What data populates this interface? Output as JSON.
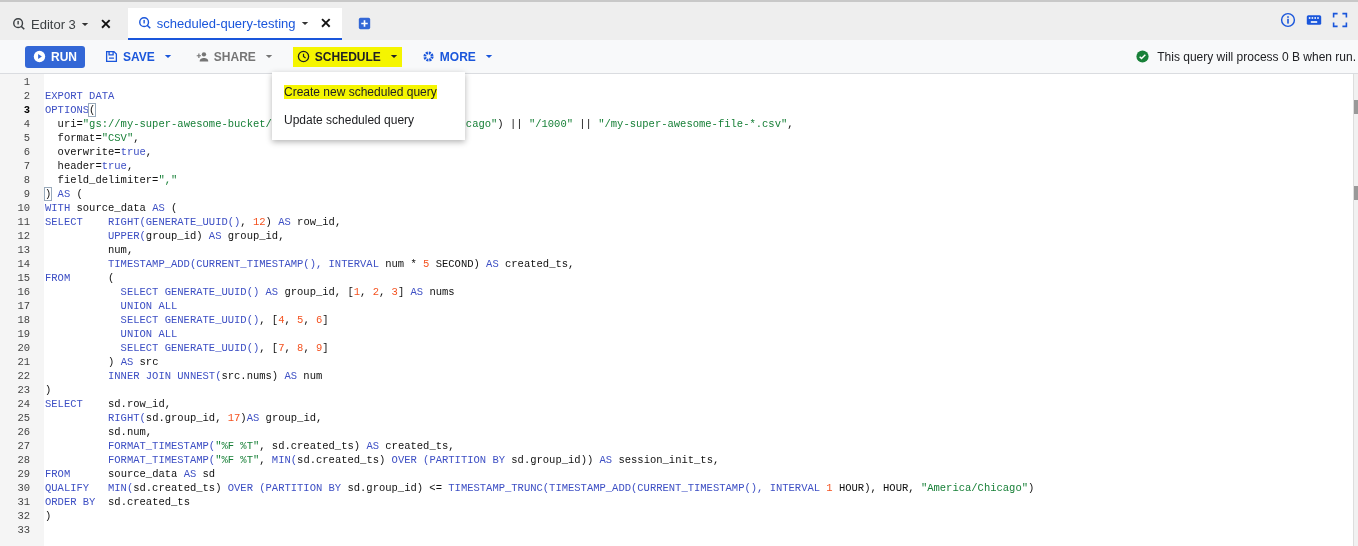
{
  "tabs": [
    {
      "label": "Editor 3",
      "selected": false,
      "close": "✕"
    },
    {
      "label": "scheduled-query-testing",
      "selected": true,
      "close": "✕"
    }
  ],
  "toolbar": [
    {
      "kind": "primary",
      "label": "RUN",
      "highlighted": false,
      "disabled": false
    },
    {
      "kind": "save",
      "label": "SAVE",
      "highlighted": false,
      "disabled": false
    },
    {
      "kind": "share",
      "label": "SHARE",
      "highlighted": false,
      "disabled": true
    },
    {
      "kind": "schedule",
      "label": "SCHEDULE",
      "highlighted": true,
      "disabled": false
    },
    {
      "kind": "more",
      "label": "MORE",
      "highlighted": false,
      "disabled": false
    }
  ],
  "status": "This query will process 0 B when run.",
  "schedule_menu": [
    {
      "label": "Create new scheduled query",
      "highlighted": true
    },
    {
      "label": "Update scheduled query",
      "highlighted": false
    }
  ],
  "editor": {
    "lines": [
      {
        "n": "1",
        "current": false
      },
      {
        "n": "2",
        "current": false,
        "tokens": [
          {
            "kind": "kw",
            "t": "EXPORT DATA"
          }
        ]
      },
      {
        "n": "3",
        "current": true,
        "tokens": [
          {
            "kind": "kw",
            "t": "OPTIONS"
          },
          {
            "kind": "bracket",
            "t": "("
          }
        ]
      },
      {
        "n": "4",
        "current": false,
        "tokens": [
          {
            "kind": "p",
            "t": "  uri="
          },
          {
            "kind": "str",
            "t": "\"gs://my-super-awesome-bucket/"
          },
          {
            "kind": "str",
            "t": "cago\"",
            "after_menu": true
          },
          {
            "kind": "p",
            "t": ") || "
          },
          {
            "kind": "str",
            "t": "\"/1000\""
          },
          {
            "kind": "p",
            "t": " || "
          },
          {
            "kind": "str",
            "t": "\"/my-super-awesome-file-*.csv\""
          },
          {
            "kind": "p",
            "t": ","
          }
        ]
      },
      {
        "n": "5",
        "current": false,
        "tokens": [
          {
            "kind": "p",
            "t": "  format="
          },
          {
            "kind": "str",
            "t": "\"CSV\""
          },
          {
            "kind": "p",
            "t": ","
          }
        ]
      },
      {
        "n": "6",
        "current": false,
        "tokens": [
          {
            "kind": "p",
            "t": "  overwrite="
          },
          {
            "kind": "kw",
            "t": "true"
          },
          {
            "kind": "p",
            "t": ","
          }
        ]
      },
      {
        "n": "7",
        "current": false,
        "tokens": [
          {
            "kind": "p",
            "t": "  header="
          },
          {
            "kind": "kw",
            "t": "true"
          },
          {
            "kind": "p",
            "t": ","
          }
        ]
      },
      {
        "n": "8",
        "current": false,
        "tokens": [
          {
            "kind": "p",
            "t": "  field_delimiter="
          },
          {
            "kind": "str",
            "t": "\",\""
          }
        ]
      },
      {
        "n": "9",
        "current": false,
        "tokens": [
          {
            "kind": "bracket",
            "t": ")"
          },
          {
            "kind": "kw",
            "t": " AS"
          },
          {
            "kind": "p",
            "t": " ("
          }
        ]
      },
      {
        "n": "10",
        "current": false,
        "tokens": [
          {
            "kind": "kw",
            "t": "WITH"
          },
          {
            "kind": "p",
            "t": " source_data "
          },
          {
            "kind": "kw",
            "t": "AS"
          },
          {
            "kind": "p",
            "t": " ("
          }
        ]
      },
      {
        "n": "11",
        "current": false,
        "tokens": [
          {
            "kind": "kw",
            "t": "SELECT    RIGHT(GENERATE_UUID()"
          },
          {
            "kind": "p",
            "t": ", "
          },
          {
            "kind": "num",
            "t": "12"
          },
          {
            "kind": "p",
            "t": ") "
          },
          {
            "kind": "kw",
            "t": "AS"
          },
          {
            "kind": "p",
            "t": " row_id,"
          }
        ]
      },
      {
        "n": "12",
        "current": false,
        "tokens": [
          {
            "kind": "kw",
            "t": "          UPPER("
          },
          {
            "kind": "p",
            "t": "group_id) "
          },
          {
            "kind": "kw",
            "t": "AS"
          },
          {
            "kind": "p",
            "t": " group_id,"
          }
        ]
      },
      {
        "n": "13",
        "current": false,
        "tokens": [
          {
            "kind": "p",
            "t": "          num,"
          }
        ]
      },
      {
        "n": "14",
        "current": false,
        "tokens": [
          {
            "kind": "kw",
            "t": "          TIMESTAMP_ADD(CURRENT_TIMESTAMP(), INTERVAL"
          },
          {
            "kind": "p",
            "t": " num * "
          },
          {
            "kind": "num",
            "t": "5"
          },
          {
            "kind": "p",
            "t": " SECOND) "
          },
          {
            "kind": "kw",
            "t": "AS"
          },
          {
            "kind": "p",
            "t": " created_ts,"
          }
        ]
      },
      {
        "n": "15",
        "current": false,
        "tokens": [
          {
            "kind": "kw",
            "t": "FROM"
          },
          {
            "kind": "p",
            "t": "      ("
          }
        ]
      },
      {
        "n": "16",
        "current": false,
        "tokens": [
          {
            "kind": "kw",
            "t": "            SELECT GENERATE_UUID() AS"
          },
          {
            "kind": "p",
            "t": " group_id, ["
          },
          {
            "kind": "num",
            "t": "1"
          },
          {
            "kind": "p",
            "t": ", "
          },
          {
            "kind": "num",
            "t": "2"
          },
          {
            "kind": "p",
            "t": ", "
          },
          {
            "kind": "num",
            "t": "3"
          },
          {
            "kind": "p",
            "t": "] "
          },
          {
            "kind": "kw",
            "t": "AS"
          },
          {
            "kind": "p",
            "t": " nums"
          }
        ]
      },
      {
        "n": "17",
        "current": false,
        "tokens": [
          {
            "kind": "kw",
            "t": "            UNION ALL"
          }
        ]
      },
      {
        "n": "18",
        "current": false,
        "tokens": [
          {
            "kind": "kw",
            "t": "            SELECT GENERATE_UUID()"
          },
          {
            "kind": "p",
            "t": ", ["
          },
          {
            "kind": "num",
            "t": "4"
          },
          {
            "kind": "p",
            "t": ", "
          },
          {
            "kind": "num",
            "t": "5"
          },
          {
            "kind": "p",
            "t": ", "
          },
          {
            "kind": "num",
            "t": "6"
          },
          {
            "kind": "p",
            "t": "]"
          }
        ]
      },
      {
        "n": "19",
        "current": false,
        "tokens": [
          {
            "kind": "kw",
            "t": "            UNION ALL"
          }
        ]
      },
      {
        "n": "20",
        "current": false,
        "tokens": [
          {
            "kind": "kw",
            "t": "            SELECT GENERATE_UUID()"
          },
          {
            "kind": "p",
            "t": ", ["
          },
          {
            "kind": "num",
            "t": "7"
          },
          {
            "kind": "p",
            "t": ", "
          },
          {
            "kind": "num",
            "t": "8"
          },
          {
            "kind": "p",
            "t": ", "
          },
          {
            "kind": "num",
            "t": "9"
          },
          {
            "kind": "p",
            "t": "]"
          }
        ]
      },
      {
        "n": "21",
        "current": false,
        "tokens": [
          {
            "kind": "p",
            "t": "          ) "
          },
          {
            "kind": "kw",
            "t": "AS"
          },
          {
            "kind": "p",
            "t": " src"
          }
        ]
      },
      {
        "n": "22",
        "current": false,
        "tokens": [
          {
            "kind": "kw",
            "t": "          INNER JOIN UNNEST("
          },
          {
            "kind": "p",
            "t": "src.nums) "
          },
          {
            "kind": "kw",
            "t": "AS"
          },
          {
            "kind": "p",
            "t": " num"
          }
        ]
      },
      {
        "n": "23",
        "current": false,
        "tokens": [
          {
            "kind": "p",
            "t": ")"
          }
        ]
      },
      {
        "n": "24",
        "current": false,
        "tokens": [
          {
            "kind": "kw",
            "t": "SELECT"
          },
          {
            "kind": "p",
            "t": "    sd.row_id,"
          }
        ]
      },
      {
        "n": "25",
        "current": false,
        "tokens": [
          {
            "kind": "kw",
            "t": "          RIGHT("
          },
          {
            "kind": "p",
            "t": "sd.group_id, "
          },
          {
            "kind": "num",
            "t": "17"
          },
          {
            "kind": "p",
            "t": ")"
          },
          {
            "kind": "kw",
            "t": "AS"
          },
          {
            "kind": "p",
            "t": " group_id,"
          }
        ]
      },
      {
        "n": "26",
        "current": false,
        "tokens": [
          {
            "kind": "p",
            "t": "          sd.num,"
          }
        ]
      },
      {
        "n": "27",
        "current": false,
        "tokens": [
          {
            "kind": "kw",
            "t": "          FORMAT_TIMESTAMP("
          },
          {
            "kind": "str",
            "t": "\"%F %T\""
          },
          {
            "kind": "p",
            "t": ", sd.created_ts) "
          },
          {
            "kind": "kw",
            "t": "AS"
          },
          {
            "kind": "p",
            "t": " created_ts,"
          }
        ]
      },
      {
        "n": "28",
        "current": false,
        "tokens": [
          {
            "kind": "kw",
            "t": "          FORMAT_TIMESTAMP("
          },
          {
            "kind": "str",
            "t": "\"%F %T\""
          },
          {
            "kind": "p",
            "t": ", "
          },
          {
            "kind": "kw",
            "t": "MIN("
          },
          {
            "kind": "p",
            "t": "sd.created_ts) "
          },
          {
            "kind": "kw",
            "t": "OVER (PARTITION BY"
          },
          {
            "kind": "p",
            "t": " sd.group_id)) "
          },
          {
            "kind": "kw",
            "t": "AS"
          },
          {
            "kind": "p",
            "t": " session_init_ts,"
          }
        ]
      },
      {
        "n": "29",
        "current": false,
        "tokens": [
          {
            "kind": "kw",
            "t": "FROM"
          },
          {
            "kind": "p",
            "t": "      source_data "
          },
          {
            "kind": "kw",
            "t": "AS"
          },
          {
            "kind": "p",
            "t": " sd"
          }
        ]
      },
      {
        "n": "30",
        "current": false,
        "tokens": [
          {
            "kind": "kw",
            "t": "QUALIFY   MIN("
          },
          {
            "kind": "p",
            "t": "sd.created_ts) "
          },
          {
            "kind": "kw",
            "t": "OVER (PARTITION BY"
          },
          {
            "kind": "p",
            "t": " sd.group_id) <= "
          },
          {
            "kind": "kw",
            "t": "TIMESTAMP_TRUNC(TIMESTAMP_ADD(CURRENT_TIMESTAMP(), INTERVAL "
          },
          {
            "kind": "num",
            "t": "1"
          },
          {
            "kind": "p",
            "t": " HOUR), HOUR, "
          },
          {
            "kind": "str",
            "t": "\"America/Chicago\""
          },
          {
            "kind": "p",
            "t": ")"
          }
        ]
      },
      {
        "n": "31",
        "current": false,
        "tokens": [
          {
            "kind": "kw",
            "t": "ORDER BY"
          },
          {
            "kind": "p",
            "t": "  sd.created_ts"
          }
        ]
      },
      {
        "n": "32",
        "current": false,
        "tokens": [
          {
            "kind": "p",
            "t": ")"
          }
        ]
      },
      {
        "n": "33",
        "current": false
      }
    ]
  }
}
